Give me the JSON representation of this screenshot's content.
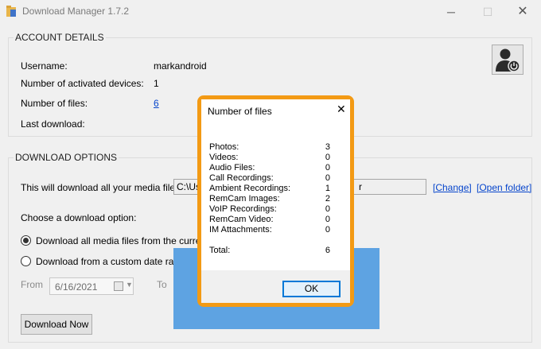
{
  "window": {
    "title": "Download Manager 1.7.2",
    "minimize": "─",
    "maximize": "☐",
    "close": "✕"
  },
  "account": {
    "section_title": "ACCOUNT DETAILS",
    "username_label": "Username:",
    "username_value": "markandroid",
    "devices_label": "Number of activated devices:",
    "devices_value": "1",
    "files_label": "Number of files:",
    "files_value": "6",
    "last_download_label": "Last download:",
    "last_download_value": ""
  },
  "download": {
    "section_title": "DOWNLOAD OPTIONS",
    "intro": "This will download all your media files to",
    "path": "C:\\Us",
    "path_tail": "r",
    "change_link": "[Change]",
    "open_folder_link": "[Open folder]",
    "choose_label": "Choose a download option:",
    "option_all": "Download all media files from the currently a",
    "option_custom": "Download from a custom date range",
    "from_label": "From",
    "from_date": "6/16/2021",
    "to_label": "To",
    "download_now": "Download Now"
  },
  "dialog": {
    "title": "Number of files",
    "close": "✕",
    "rows": [
      {
        "label": "Photos:",
        "value": "3"
      },
      {
        "label": "Videos:",
        "value": "0"
      },
      {
        "label": "Audio Files:",
        "value": "0"
      },
      {
        "label": "Call Recordings:",
        "value": "0"
      },
      {
        "label": "Ambient Recordings:",
        "value": "1"
      },
      {
        "label": "RemCam Images:",
        "value": "2"
      },
      {
        "label": "VoIP Recordings:",
        "value": "0"
      },
      {
        "label": "RemCam Video:",
        "value": "0"
      },
      {
        "label": "IM Attachments:",
        "value": "0"
      }
    ],
    "total_label": "Total:",
    "total_value": "6",
    "ok": "OK"
  },
  "colors": {
    "accent": "#f39a14",
    "link": "#0645cc",
    "overlay_blue": "#5ea3e2",
    "ok_border": "#0078d7"
  },
  "icons": [
    "folder-app-icon",
    "user-power-icon",
    "calendar-icon",
    "dropdown-arrow-icon"
  ]
}
